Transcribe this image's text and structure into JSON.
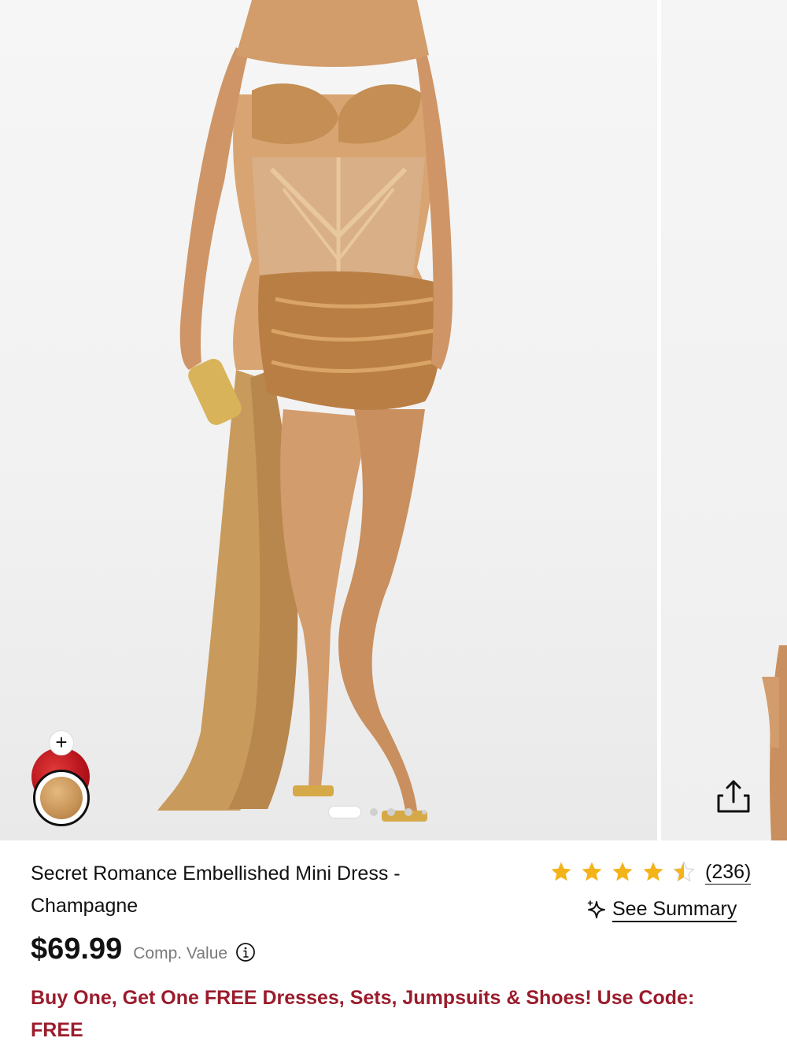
{
  "gallery": {
    "slide_count": 5,
    "active_slide": 1,
    "current_color": "Champagne",
    "colors": {
      "gold_swatch": "#c99558",
      "red_swatch": "#b3121a"
    }
  },
  "product": {
    "title": "Secret Romance Embellished Mini Dress - Champagne",
    "price": "$69.99",
    "comp_value_label": "Comp. Value",
    "rating_value": 4.5,
    "review_count": "(236)",
    "summary_label": "See Summary",
    "promo": "Buy One, Get One FREE Dresses, Sets, Jumpsuits & Shoes! Use Code: FREE"
  },
  "colors": {
    "star": "#f5b31a",
    "promo": "#9b1c2c",
    "text": "#111111",
    "muted": "#7a7a7a"
  }
}
